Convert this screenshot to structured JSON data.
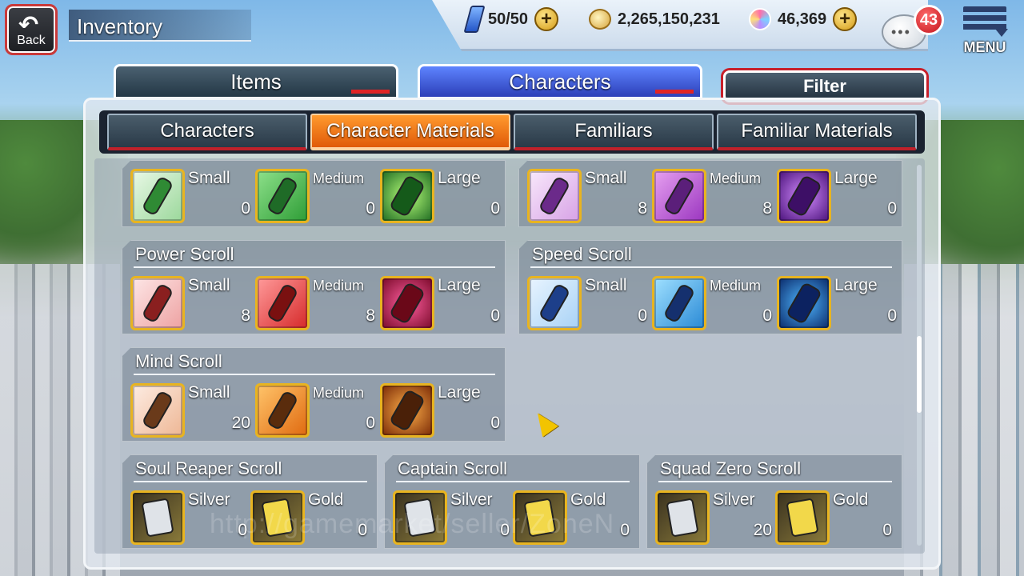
{
  "header": {
    "back_label": "Back",
    "title": "Inventory",
    "stamina": "50/50",
    "gold": "2,265,150,231",
    "orbs": "46,369",
    "notifications": "43",
    "menu_label": "MENU",
    "icons": [
      "back-arrow-icon",
      "stamina-icon",
      "coin-icon",
      "spirit-orb-icon",
      "plus-icon",
      "chat-icon",
      "menu-icon"
    ]
  },
  "top_tabs": {
    "items": "Items",
    "characters": "Characters",
    "filter": "Filter",
    "active": "characters"
  },
  "sub_tabs": {
    "tabs": [
      "Characters",
      "Character Materials",
      "Familiars",
      "Familiar Materials"
    ],
    "active": "Character Materials"
  },
  "colors": {
    "active_subtab": "#f07a16",
    "active_toptab": "#3a56e0",
    "icon_frame": "#e8b420"
  },
  "cards": [
    {
      "title": "",
      "items": [
        {
          "label": "Small",
          "count": "0"
        },
        {
          "label": "Medium",
          "count": "0"
        },
        {
          "label": "Large",
          "count": "0"
        }
      ]
    },
    {
      "title": "",
      "items": [
        {
          "label": "Small",
          "count": "8"
        },
        {
          "label": "Medium",
          "count": "8"
        },
        {
          "label": "Large",
          "count": "0"
        }
      ]
    },
    {
      "title": "Power Scroll",
      "items": [
        {
          "label": "Small",
          "count": "8"
        },
        {
          "label": "Medium",
          "count": "8"
        },
        {
          "label": "Large",
          "count": "0"
        }
      ]
    },
    {
      "title": "Speed Scroll",
      "items": [
        {
          "label": "Small",
          "count": "0"
        },
        {
          "label": "Medium",
          "count": "0"
        },
        {
          "label": "Large",
          "count": "0"
        }
      ]
    },
    {
      "title": "Mind Scroll",
      "items": [
        {
          "label": "Small",
          "count": "20"
        },
        {
          "label": "Medium",
          "count": "0"
        },
        {
          "label": "Large",
          "count": "0"
        }
      ]
    },
    {
      "title": "Soul Reaper Scroll",
      "items": [
        {
          "label": "Silver",
          "count": "0"
        },
        {
          "label": "Gold",
          "count": "0"
        }
      ]
    },
    {
      "title": "Captain Scroll",
      "items": [
        {
          "label": "Silver",
          "count": "0"
        },
        {
          "label": "Gold",
          "count": "0"
        }
      ]
    },
    {
      "title": "Squad Zero Scroll",
      "items": [
        {
          "label": "Silver",
          "count": "20"
        },
        {
          "label": "Gold",
          "count": "0"
        }
      ]
    }
  ],
  "watermark": "http://gamemarket/seller/ZoneN"
}
